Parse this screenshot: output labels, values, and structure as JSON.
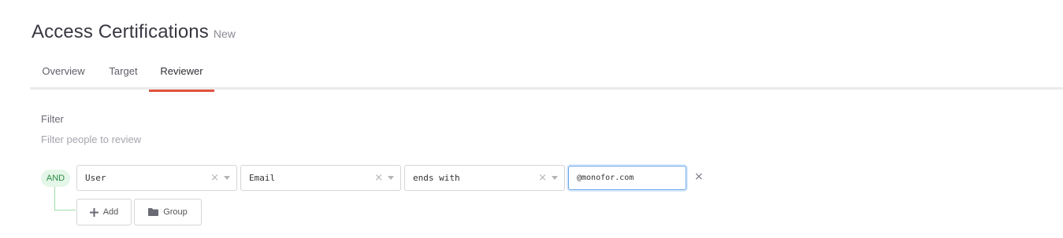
{
  "header": {
    "title": "Access Certifications",
    "status": "New"
  },
  "tabs": [
    {
      "label": "Overview",
      "active": false
    },
    {
      "label": "Target",
      "active": false
    },
    {
      "label": "Reviewer",
      "active": true
    }
  ],
  "filter": {
    "label": "Filter",
    "help": "Filter people to review",
    "operator": "AND",
    "rule": {
      "entity": "User",
      "attribute": "Email",
      "condition": "ends with",
      "value": "@monofor.com"
    },
    "add_label": "Add",
    "group_label": "Group"
  },
  "colors": {
    "accent": "#e0523e",
    "and_bg": "#e3f6e7",
    "and_text": "#2c8a45",
    "focus": "#6aa8e8"
  },
  "icons": {
    "clear": "x-icon",
    "dropdown": "chevron-down-icon",
    "remove": "close-icon",
    "add": "plus-icon",
    "group": "folder-icon"
  }
}
